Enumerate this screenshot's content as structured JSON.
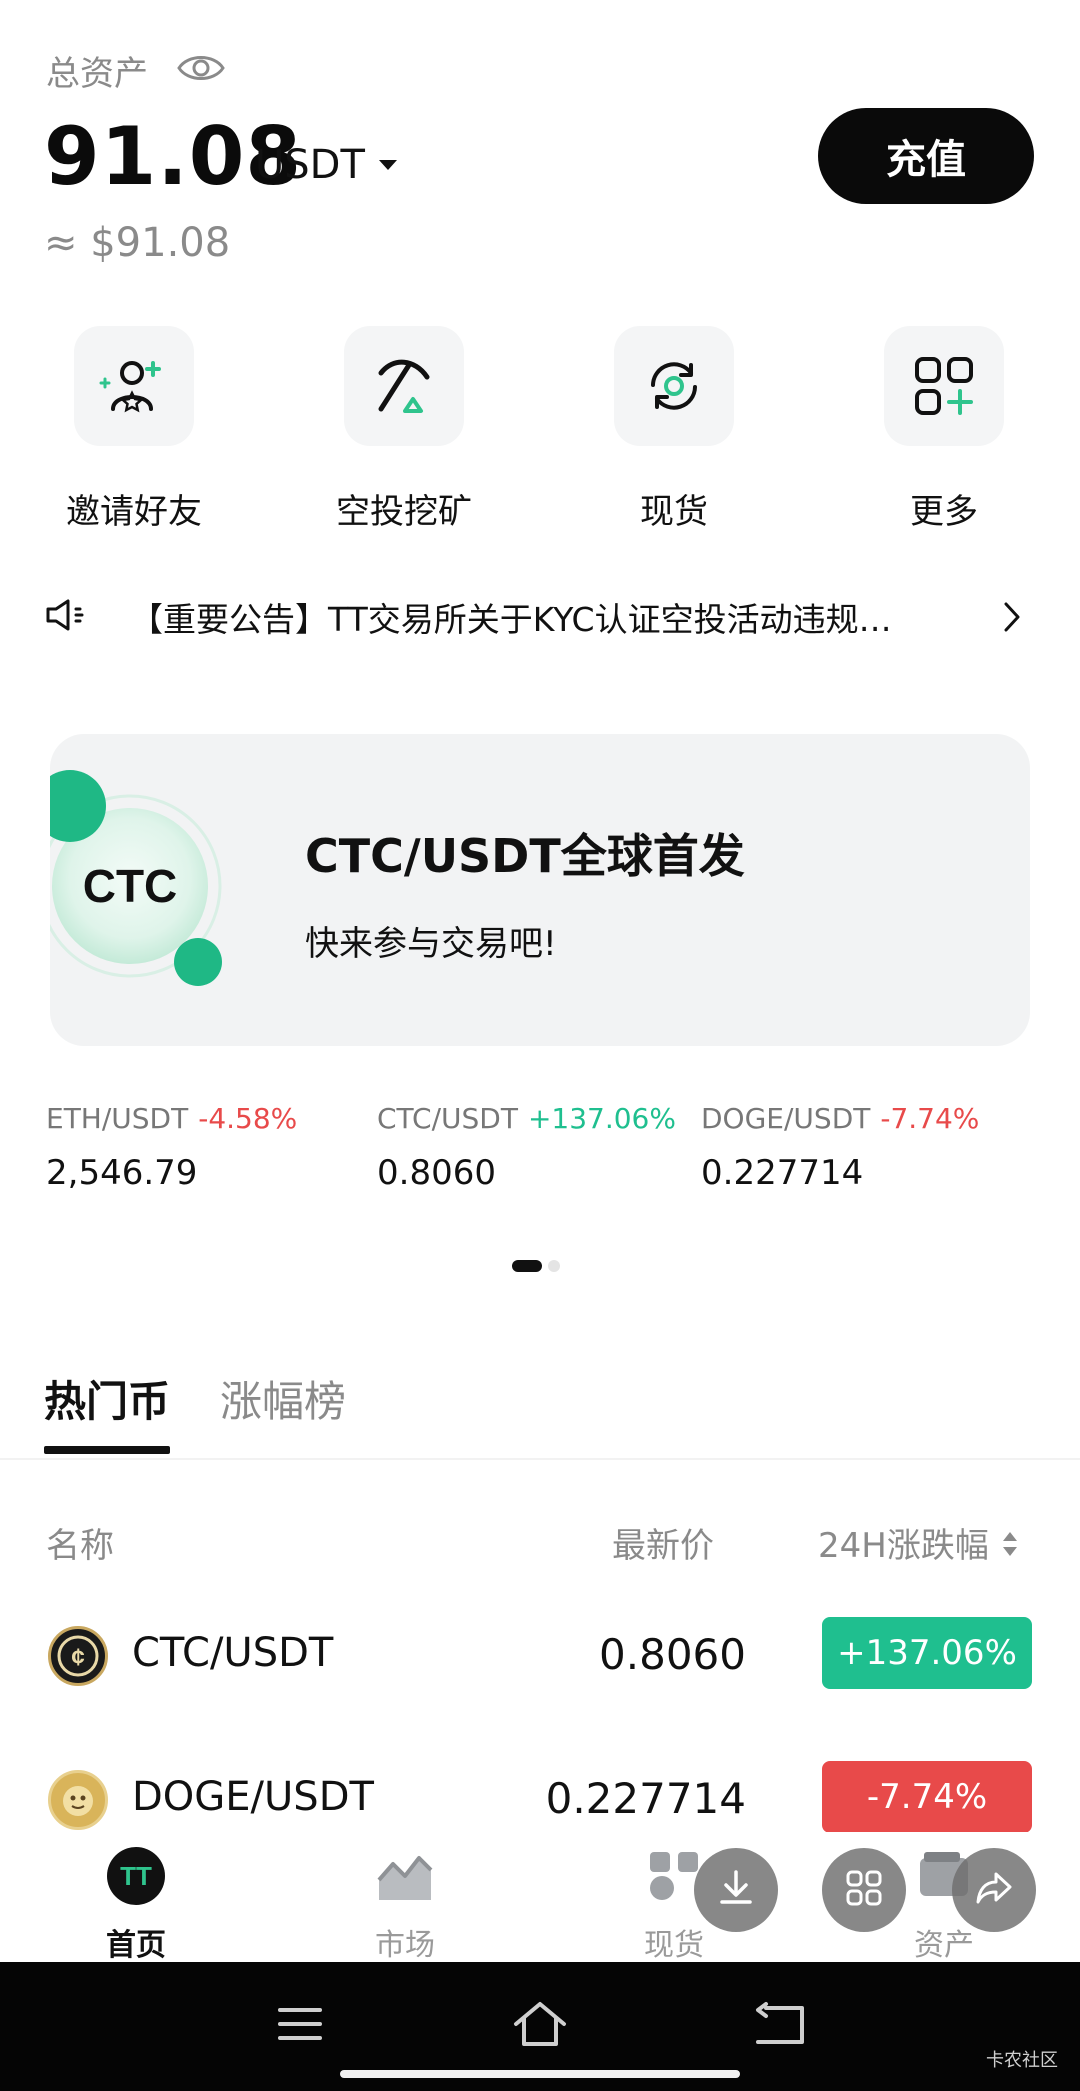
{
  "header": {
    "assets_label": "总资产",
    "amount": "91.08",
    "unit": "USDT",
    "usd_approx": "≈ $91.08",
    "deposit_label": "充值"
  },
  "quick_actions": [
    {
      "label": "邀请好友",
      "icon": "invite-friends-icon"
    },
    {
      "label": "空投挖矿",
      "icon": "pickaxe-icon"
    },
    {
      "label": "现货",
      "icon": "spot-icon"
    },
    {
      "label": "更多",
      "icon": "more-grid-icon"
    }
  ],
  "notice": {
    "text": "【重要公告】TT交易所关于KYC认证空投活动违规…"
  },
  "banner": {
    "logo_text": "CTC",
    "title": "CTC/USDT全球首发",
    "subtitle": "快来参与交易吧!"
  },
  "tickers": [
    {
      "pair": "ETH/USDT",
      "change": "-4.58%",
      "price": "2,546.79",
      "direction": "down"
    },
    {
      "pair": "CTC/USDT",
      "change": "+137.06%",
      "price": "0.8060",
      "direction": "up"
    },
    {
      "pair": "DOGE/USDT",
      "change": "-7.74%",
      "price": "0.227714",
      "direction": "down"
    }
  ],
  "tabs": {
    "hot": "热门币",
    "gainers": "涨幅榜"
  },
  "table": {
    "col_name": "名称",
    "col_price": "最新价",
    "col_change": "24H涨跌幅",
    "rows": [
      {
        "pair": "CTC/USDT",
        "price": "0.8060",
        "change": "+137.06%",
        "direction": "up"
      },
      {
        "pair": "DOGE/USDT",
        "price": "0.227714",
        "change": "-7.74%",
        "direction": "down"
      }
    ]
  },
  "bottom_nav": [
    {
      "label": "首页",
      "active": true
    },
    {
      "label": "市场",
      "active": false
    },
    {
      "label": "现货",
      "active": false
    },
    {
      "label": "资产",
      "active": false
    }
  ],
  "watermark": "卡农社区",
  "colors": {
    "up": "#1fbf8f",
    "down": "#e84a4a",
    "brand": "#2fc48d"
  }
}
